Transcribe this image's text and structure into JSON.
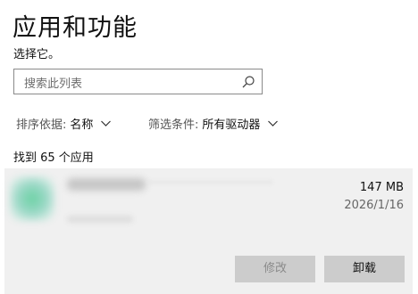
{
  "header": {
    "title": "应用和功能",
    "subtitle": "选择它。"
  },
  "search": {
    "placeholder": "搜索此列表",
    "icon": "search-icon"
  },
  "sort": {
    "label": "排序依据:",
    "value": "名称"
  },
  "filter": {
    "label": "筛选条件:",
    "value": "所有驱动器"
  },
  "results": {
    "count_text": "找到 65 个应用"
  },
  "app": {
    "size": "147 MB",
    "date": "2026/1/16",
    "modify_label": "修改",
    "uninstall_label": "卸载"
  },
  "colors": {
    "card_background": "#f0f0f0",
    "button_background": "#cccccc",
    "disabled_text": "#8a8a8a"
  }
}
